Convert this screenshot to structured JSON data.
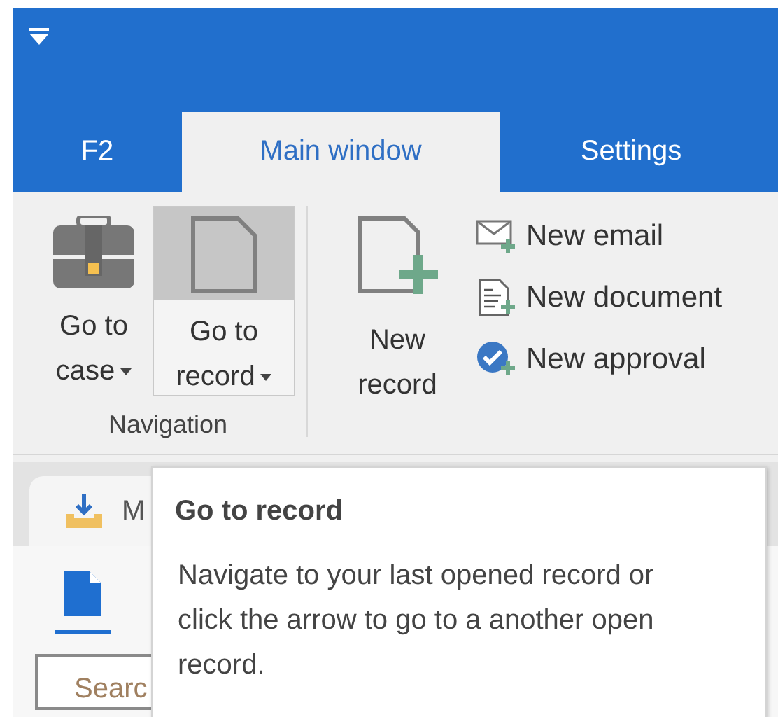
{
  "header": {
    "tabs": [
      {
        "label": "F2",
        "selected": false
      },
      {
        "label": "Main window",
        "selected": true
      },
      {
        "label": "Settings",
        "selected": false
      }
    ]
  },
  "ribbon": {
    "groups": [
      {
        "label": "Navigation",
        "buttons": [
          {
            "kind": "case",
            "label": "Go to case",
            "dropdown": true,
            "highlighted": false
          },
          {
            "kind": "record",
            "label": "Go to record",
            "dropdown": true,
            "highlighted": true
          }
        ]
      },
      {
        "buttons": [
          {
            "kind": "new-record",
            "label": "New record",
            "dropdown": false,
            "highlighted": false
          }
        ],
        "small_buttons": [
          {
            "kind": "email",
            "label": "New email"
          },
          {
            "kind": "document",
            "label": "New document"
          },
          {
            "kind": "approval",
            "label": "New approval"
          }
        ]
      }
    ]
  },
  "document_tab": {
    "label": "M"
  },
  "search": {
    "placeholder": "Searc"
  },
  "tooltip": {
    "title": "Go to record",
    "body": "Navigate to your last opened record or click the arrow to go to a another open record."
  }
}
